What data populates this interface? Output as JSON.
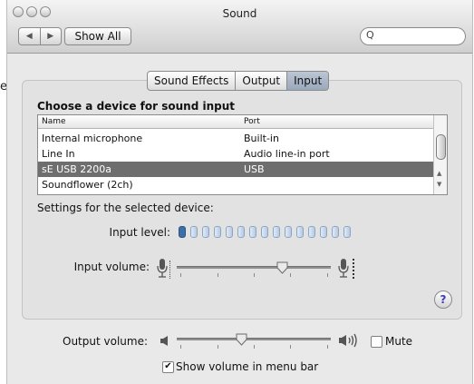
{
  "background_fragment": "e",
  "window": {
    "title": "Sound",
    "nav_back_icon": "◀",
    "nav_forward_icon": "▶",
    "show_all_label": "Show All",
    "search_icon_glyph": "Q",
    "search_value": ""
  },
  "tabs": [
    {
      "label": "Sound Effects",
      "selected": false
    },
    {
      "label": "Output",
      "selected": false
    },
    {
      "label": "Input",
      "selected": true
    }
  ],
  "input_pane": {
    "heading": "Choose a device for sound input",
    "columns": {
      "name": "Name",
      "port": "Port"
    },
    "devices": [
      {
        "name": "Internal microphone",
        "port": "Built-in",
        "selected": false
      },
      {
        "name": "Line In",
        "port": "Audio line-in port",
        "selected": false
      },
      {
        "name": "sE USB 2200a",
        "port": "USB",
        "selected": true
      },
      {
        "name": "Soundflower (2ch)",
        "port": "",
        "selected": false
      }
    ],
    "settings_label": "Settings for the selected device:",
    "input_level_label": "Input level:",
    "input_level": {
      "segments": 15,
      "active": 1
    },
    "input_volume_label": "Input volume:",
    "input_volume_fraction": 0.68,
    "help_label": "?"
  },
  "output": {
    "volume_label": "Output volume:",
    "volume_fraction": 0.42,
    "mute_label": "Mute",
    "mute_checked": false,
    "show_volume_label": "Show volume in menu bar",
    "show_volume_checked": true
  }
}
